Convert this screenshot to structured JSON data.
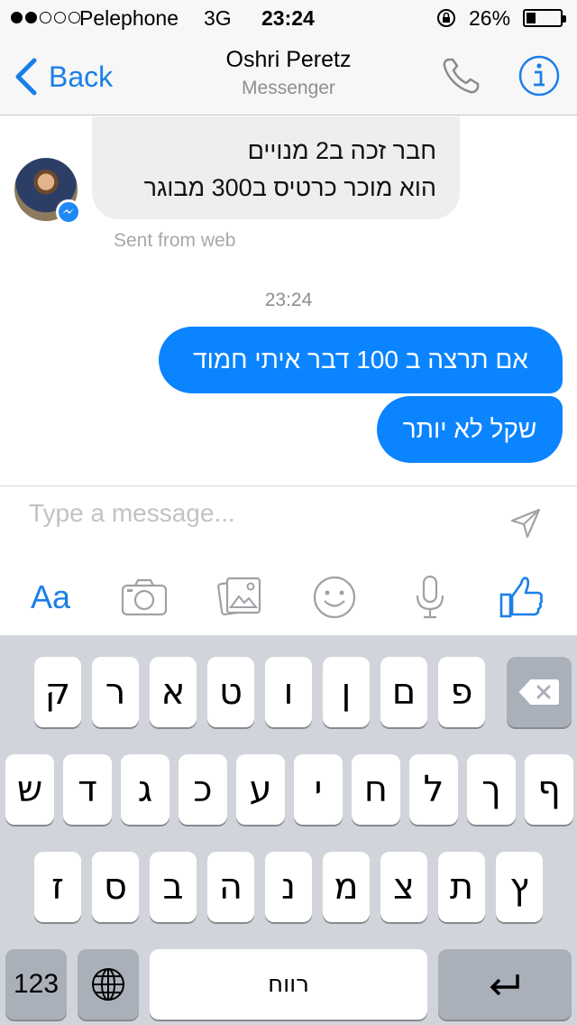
{
  "status_bar": {
    "carrier": "Pelephone",
    "network": "3G",
    "time": "23:24",
    "battery": "26%",
    "signal_bars_filled": 2,
    "signal_bars_total": 5,
    "battery_level": 0.26
  },
  "nav": {
    "back_label": "Back",
    "title": "Oshri Peretz",
    "subtitle": "Messenger"
  },
  "conversation": {
    "incoming": {
      "lines": [
        "חבר זכה ב2 מנויים",
        "הוא מוכר כרטיס ב300 מבוגר"
      ],
      "footer": "Sent from web"
    },
    "timestamp": "23:24",
    "outgoing": [
      "אם תרצה ב 100 דבר איתי חמוד",
      "שקל לא יותר"
    ]
  },
  "composer": {
    "placeholder": "Type a message...",
    "tools": {
      "text_label": "Aa",
      "icons": [
        "camera-icon",
        "gallery-icon",
        "emoji-icon",
        "microphone-icon",
        "like-icon"
      ]
    }
  },
  "keyboard": {
    "row1": [
      "ק",
      "ר",
      "א",
      "ט",
      "ו",
      "ן",
      "ם",
      "פ"
    ],
    "row2": [
      "ש",
      "ד",
      "ג",
      "כ",
      "ע",
      "י",
      "ח",
      "ל",
      "ך",
      "ף"
    ],
    "row3": [
      "ז",
      "ס",
      "ב",
      "ה",
      "נ",
      "מ",
      "צ",
      "ת",
      "ץ"
    ],
    "numbers_label": "123",
    "space_label": "רווח",
    "delete_icon": "delete-icon",
    "globe_icon": "globe-icon",
    "return_icon": "return-icon"
  },
  "colors": {
    "accent": "#0a84ff",
    "incoming_bubble": "#eeeef0",
    "keyboard_bg": "#d1d5db"
  }
}
